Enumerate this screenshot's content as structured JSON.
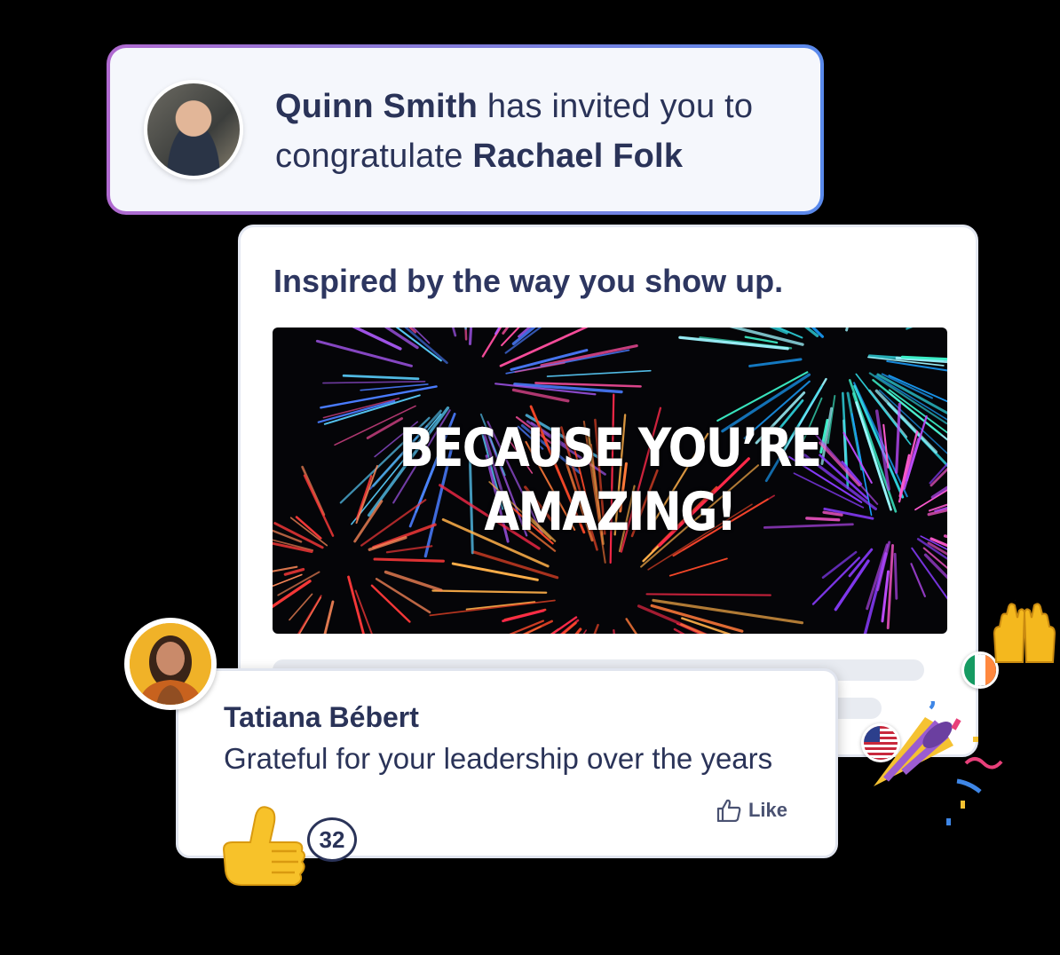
{
  "invite": {
    "inviter_name": "Quinn Smith",
    "middle_text": "has invited you to",
    "prefix_text": "congratulate",
    "recipient_name": "Rachael Folk"
  },
  "post": {
    "title": "Inspired by the way you show up.",
    "banner_line1": "BECAUSE YOU’RE",
    "banner_line2": "AMAZING!"
  },
  "comment": {
    "author": "Tatiana Bébert",
    "text": "Grateful for your leadership over the years",
    "like_label": "Like",
    "like_count": "32"
  },
  "icons": {
    "thumbs_up": "thumbs-up-emoji",
    "raised_hands": "raising-hands-emoji",
    "party_popper": "party-popper-emoji",
    "flag_us": "flag-us",
    "flag_ie": "flag-ireland"
  },
  "colors": {
    "text_primary": "#2a3358",
    "gradient_start": "#b06ad0",
    "gradient_end": "#5a8aec",
    "avatar_bg": "#f0b228"
  }
}
